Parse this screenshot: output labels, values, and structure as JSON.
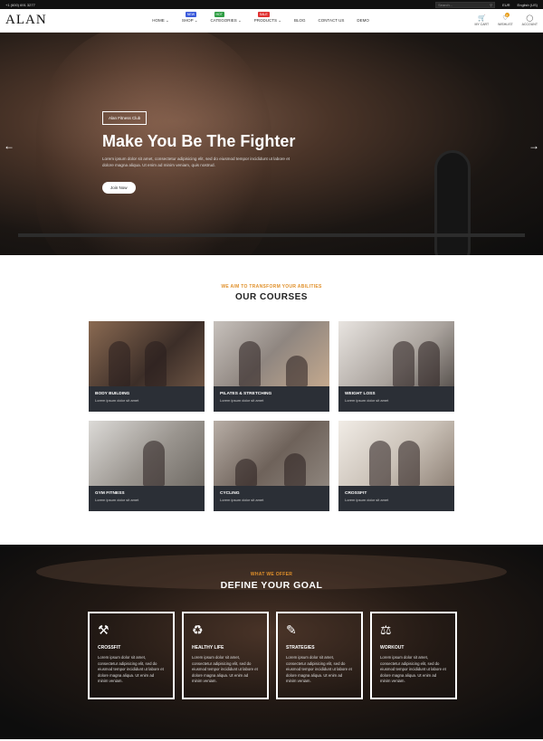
{
  "topbar": {
    "phone": "+1 (600) 691 3277",
    "search_placeholder": "Search...",
    "currency": "EUR",
    "language": "English (US)"
  },
  "header": {
    "logo": "ALAN",
    "nav": [
      {
        "label": "HOME",
        "badge": "",
        "badge_color": ""
      },
      {
        "label": "SHOP",
        "badge": "NEW",
        "badge_color": "#3b5bdb"
      },
      {
        "label": "CATEGORIES",
        "badge": "HOT",
        "badge_color": "#2f9e44"
      },
      {
        "label": "PRODUCTS",
        "badge": "SALE",
        "badge_color": "#e03131"
      },
      {
        "label": "BLOG",
        "badge": "",
        "badge_color": ""
      },
      {
        "label": "CONTACT US",
        "badge": "",
        "badge_color": ""
      },
      {
        "label": "DEMO",
        "badge": "",
        "badge_color": ""
      }
    ],
    "icons": [
      {
        "icon": "cart-icon",
        "label": "MY CART",
        "count": ""
      },
      {
        "icon": "heart-icon",
        "label": "WISHLIST",
        "count": "0"
      },
      {
        "icon": "user-icon",
        "label": "ACCOUNT",
        "count": ""
      }
    ]
  },
  "hero": {
    "tag": "Alan Fitness Club",
    "title": "Make You Be The Fighter",
    "text": "Lorem ipsum dolor sit amet, consectetur adipisicing elit, sed do eiusmod tempor incididunt ut labore et dolore magna aliqua. Ut enim ad minim veniam, quis nostrud.",
    "button": "Join Now"
  },
  "courses": {
    "eyebrow": "WE AIM TO TRANSFORM YOUR ABILITIES",
    "title": "OUR COURSES",
    "items": [
      {
        "title": "BODY BUILDING",
        "sub": "Lorem ipsum dolor sit amet"
      },
      {
        "title": "PILATES & STRETCHING",
        "sub": "Lorem ipsum dolor sit amet"
      },
      {
        "title": "WEIGHT LOSS",
        "sub": "Lorem ipsum dolor sit amet"
      },
      {
        "title": "GYM FITNESS",
        "sub": "Lorem ipsum dolor sit amet"
      },
      {
        "title": "CYCLING",
        "sub": "Lorem ipsum dolor sit amet"
      },
      {
        "title": "CROSSFIT",
        "sub": "Lorem ipsum dolor sit amet"
      }
    ]
  },
  "goal": {
    "eyebrow": "WHAT WE OFFER",
    "title": "DEFINE YOUR GOAL",
    "items": [
      {
        "icon": "kettlebell-icon",
        "title": "CROSSFIT",
        "text": "Lorem ipsum dolor sit amet, consectetur adipisicing elit, sed do eiusmod tempor incididunt ut labore et dolore magna aliqua. Ut enim ad minim veniam."
      },
      {
        "icon": "supplement-icon",
        "title": "HEALTHY LIFE",
        "text": "Lorem ipsum dolor sit amet, consectetur adipisicing elit, sed do eiusmod tempor incididunt ut labore et dolore magna aliqua. Ut enim ad minim veniam."
      },
      {
        "icon": "clipboard-icon",
        "title": "STRATEGIES",
        "text": "Lorem ipsum dolor sit amet, consectetur adipisicing elit, sed do eiusmod tempor incididunt ut labore et dolore magna aliqua. Ut enim ad minim veniam."
      },
      {
        "icon": "scale-icon",
        "title": "WORKOUT",
        "text": "Lorem ipsum dolor sit amet, consectetur adipisicing elit, sed do eiusmod tempor incididunt ut labore et dolore magna aliqua. Ut enim ad minim veniam."
      }
    ]
  }
}
